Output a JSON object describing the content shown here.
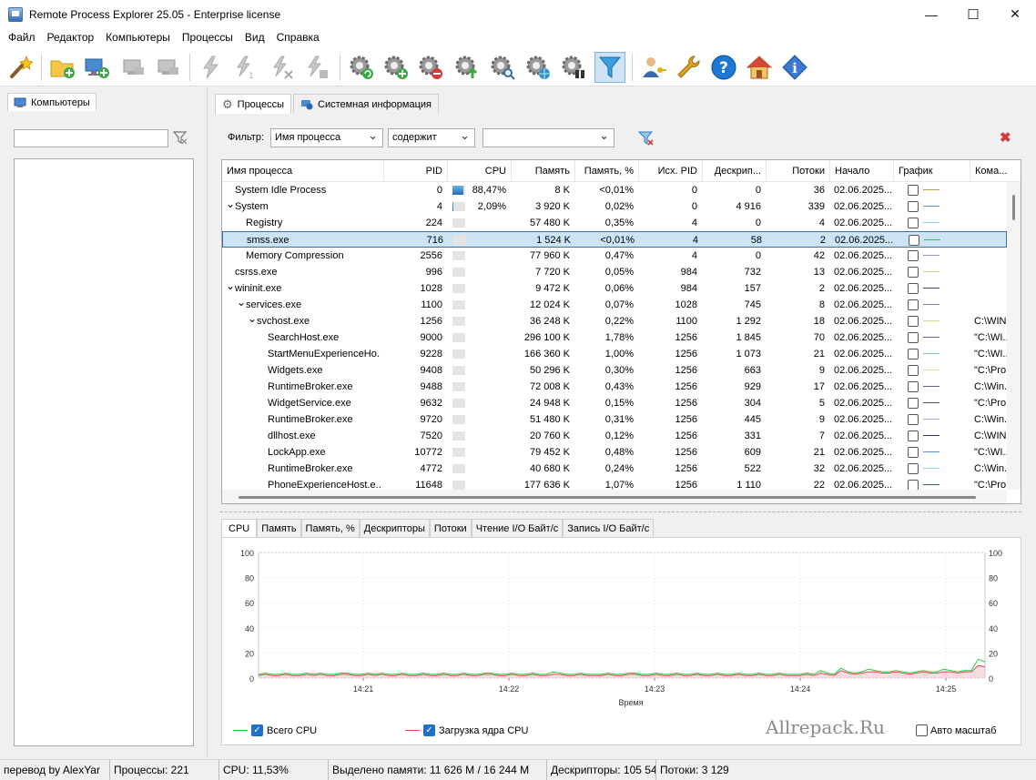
{
  "window": {
    "title": "Remote Process Explorer 25.05 - Enterprise license",
    "minimize": "—",
    "maximize": "☐",
    "close": "✕"
  },
  "menu": [
    "Файл",
    "Редактор",
    "Компьютеры",
    "Процессы",
    "Вид",
    "Справка"
  ],
  "toolbar_icons": [
    "wizard-icon",
    "add-folder-icon",
    "add-computer-icon",
    "computer-disabled-icon",
    "computer-disabled-icon-2",
    "run-disabled-icon",
    "run-disabled-icon-2",
    "run-disabled-icon-3",
    "run-disabled-icon-4",
    "gear-refresh-icon",
    "gear-add-icon",
    "gear-remove-icon",
    "gear-up-icon",
    "gear-search-icon",
    "gear-globe-icon",
    "gear-binoculars-icon",
    "filter-icon",
    "user-key-icon",
    "wrench-icon",
    "help-icon",
    "home-icon",
    "info-icon"
  ],
  "left": {
    "tab_label": "Компьютеры",
    "search_value": ""
  },
  "tabs": {
    "processes": "Процессы",
    "sysinfo": "Системная информация"
  },
  "filter": {
    "label": "Фильтр:",
    "field": "Имя процесса",
    "condition": "содержит",
    "value": ""
  },
  "columns": [
    "Имя процесса",
    "PID",
    "CPU",
    "Память",
    "Память, %",
    "Исх. PID",
    "Дескрип...",
    "Потоки",
    "Начало",
    "График",
    "Кома..."
  ],
  "rows": [
    {
      "name": "System Idle Process",
      "indent": 0,
      "expand": "",
      "pid": "0",
      "cpu": "88,47%",
      "cpu_level": 0.88,
      "mem": "8 K",
      "mem_pct": "<0,01%",
      "ppid": "0",
      "handles": "0",
      "threads": "36",
      "start": "02.06.2025...",
      "graph_color": "#b59a5a",
      "cmd": "",
      "selected": false
    },
    {
      "name": "System",
      "indent": 0,
      "expand": "⌄",
      "pid": "4",
      "cpu": "2,09%",
      "cpu_level": 0.1,
      "mem": "3 920 K",
      "mem_pct": "0,02%",
      "ppid": "0",
      "handles": "4 916",
      "threads": "339",
      "start": "02.06.2025...",
      "graph_color": "#5a9bd8",
      "cmd": "",
      "selected": false
    },
    {
      "name": "Registry",
      "indent": 1,
      "expand": "",
      "pid": "224",
      "cpu": "",
      "cpu_level": 0,
      "mem": "57 480 K",
      "mem_pct": "0,35%",
      "ppid": "4",
      "handles": "0",
      "threads": "4",
      "start": "02.06.2025...",
      "graph_color": "#9ccbe8",
      "cmd": "",
      "selected": false
    },
    {
      "name": "smss.exe",
      "indent": 1,
      "expand": "",
      "pid": "716",
      "cpu": "",
      "cpu_level": 0,
      "mem": "1 524 K",
      "mem_pct": "<0,01%",
      "ppid": "4",
      "handles": "58",
      "threads": "2",
      "start": "02.06.2025...",
      "graph_color": "#3cb371",
      "cmd": "",
      "selected": true
    },
    {
      "name": "Memory Compression",
      "indent": 1,
      "expand": "",
      "pid": "2556",
      "cpu": "",
      "cpu_level": 0,
      "mem": "77 960 K",
      "mem_pct": "0,47%",
      "ppid": "4",
      "handles": "0",
      "threads": "42",
      "start": "02.06.2025...",
      "graph_color": "#a78bd0",
      "cmd": "",
      "selected": false
    },
    {
      "name": "csrss.exe",
      "indent": 0,
      "expand": "",
      "pid": "996",
      "cpu": "",
      "cpu_level": 0,
      "mem": "7 720 K",
      "mem_pct": "0,05%",
      "ppid": "984",
      "handles": "732",
      "threads": "13",
      "start": "02.06.2025...",
      "graph_color": "#c9d98a",
      "cmd": "",
      "selected": false
    },
    {
      "name": "wininit.exe",
      "indent": 0,
      "expand": "⌄",
      "pid": "1028",
      "cpu": "",
      "cpu_level": 0,
      "mem": "9 472 K",
      "mem_pct": "0,06%",
      "ppid": "984",
      "handles": "157",
      "threads": "2",
      "start": "02.06.2025...",
      "graph_color": "#3a4a8a",
      "cmd": "",
      "selected": false
    },
    {
      "name": "services.exe",
      "indent": 1,
      "expand": "⌄",
      "pid": "1100",
      "cpu": "",
      "cpu_level": 0,
      "mem": "12 024 K",
      "mem_pct": "0,07%",
      "ppid": "1028",
      "handles": "745",
      "threads": "8",
      "start": "02.06.2025...",
      "graph_color": "#8a7ab8",
      "cmd": "",
      "selected": false
    },
    {
      "name": "svchost.exe",
      "indent": 2,
      "expand": "⌄",
      "pid": "1256",
      "cpu": "",
      "cpu_level": 0,
      "mem": "36 248 K",
      "mem_pct": "0,22%",
      "ppid": "1100",
      "handles": "1 292",
      "threads": "18",
      "start": "02.06.2025...",
      "graph_color": "#d8d89a",
      "cmd": "C:\\WIN",
      "selected": false
    },
    {
      "name": "SearchHost.exe",
      "indent": 3,
      "expand": "",
      "pid": "9000",
      "cpu": "",
      "cpu_level": 0,
      "mem": "296 100 K",
      "mem_pct": "1,78%",
      "ppid": "1256",
      "handles": "1 845",
      "threads": "70",
      "start": "02.06.2025...",
      "graph_color": "#5a6aa8",
      "cmd": "\"C:\\WI...",
      "selected": false
    },
    {
      "name": "StartMenuExperienceHo...",
      "indent": 3,
      "expand": "",
      "pid": "9228",
      "cpu": "",
      "cpu_level": 0,
      "mem": "166 360 K",
      "mem_pct": "1,00%",
      "ppid": "1256",
      "handles": "1 073",
      "threads": "21",
      "start": "02.06.2025...",
      "graph_color": "#7ac8b0",
      "cmd": "\"C:\\WI...",
      "selected": false
    },
    {
      "name": "Widgets.exe",
      "indent": 3,
      "expand": "",
      "pid": "9408",
      "cpu": "",
      "cpu_level": 0,
      "mem": "50 296 K",
      "mem_pct": "0,30%",
      "ppid": "1256",
      "handles": "663",
      "threads": "9",
      "start": "02.06.2025...",
      "graph_color": "#d8e09a",
      "cmd": "\"C:\\Pro",
      "selected": false
    },
    {
      "name": "RuntimeBroker.exe",
      "indent": 3,
      "expand": "",
      "pid": "9488",
      "cpu": "",
      "cpu_level": 0,
      "mem": "72 008 K",
      "mem_pct": "0,43%",
      "ppid": "1256",
      "handles": "929",
      "threads": "17",
      "start": "02.06.2025...",
      "graph_color": "#6a5a9a",
      "cmd": "C:\\Win.",
      "selected": false
    },
    {
      "name": "WidgetService.exe",
      "indent": 3,
      "expand": "",
      "pid": "9632",
      "cpu": "",
      "cpu_level": 0,
      "mem": "24 948 K",
      "mem_pct": "0,15%",
      "ppid": "1256",
      "handles": "304",
      "threads": "5",
      "start": "02.06.2025...",
      "graph_color": "#555",
      "cmd": "\"C:\\Pro",
      "selected": false
    },
    {
      "name": "RuntimeBroker.exe",
      "indent": 3,
      "expand": "",
      "pid": "9720",
      "cpu": "",
      "cpu_level": 0,
      "mem": "51 480 K",
      "mem_pct": "0,31%",
      "ppid": "1256",
      "handles": "445",
      "threads": "9",
      "start": "02.06.2025...",
      "graph_color": "#b89ad8",
      "cmd": "C:\\Win.",
      "selected": false
    },
    {
      "name": "dllhost.exe",
      "indent": 3,
      "expand": "",
      "pid": "7520",
      "cpu": "",
      "cpu_level": 0,
      "mem": "20 760 K",
      "mem_pct": "0,12%",
      "ppid": "1256",
      "handles": "331",
      "threads": "7",
      "start": "02.06.2025...",
      "graph_color": "#2a3a7a",
      "cmd": "C:\\WIN",
      "selected": false
    },
    {
      "name": "LockApp.exe",
      "indent": 3,
      "expand": "",
      "pid": "10772",
      "cpu": "",
      "cpu_level": 0,
      "mem": "79 452 K",
      "mem_pct": "0,48%",
      "ppid": "1256",
      "handles": "609",
      "threads": "21",
      "start": "02.06.2025...",
      "graph_color": "#5a8ad8",
      "cmd": "\"C:\\WI...",
      "selected": false
    },
    {
      "name": "RuntimeBroker.exe",
      "indent": 3,
      "expand": "",
      "pid": "4772",
      "cpu": "",
      "cpu_level": 0,
      "mem": "40 680 K",
      "mem_pct": "0,24%",
      "ppid": "1256",
      "handles": "522",
      "threads": "32",
      "start": "02.06.2025...",
      "graph_color": "#8adcc8",
      "cmd": "C:\\Win.",
      "selected": false
    },
    {
      "name": "PhoneExperienceHost.e...",
      "indent": 3,
      "expand": "",
      "pid": "11648",
      "cpu": "",
      "cpu_level": 0,
      "mem": "177 636 K",
      "mem_pct": "1,07%",
      "ppid": "1256",
      "handles": "1 110",
      "threads": "22",
      "start": "02.06.2025...",
      "graph_color": "#3a5aa8",
      "cmd": "\"C:\\Pro",
      "selected": false
    }
  ],
  "chart_tabs": [
    "CPU",
    "Память",
    "Память, %",
    "Дескрипторы",
    "Потоки",
    "Чтение I/O Байт/с",
    "Запись I/O Байт/с"
  ],
  "chart_data": {
    "type": "line",
    "xlabel": "Время",
    "ylabel": "",
    "ylim": [
      0,
      100
    ],
    "yticks": [
      "0",
      "20",
      "40",
      "60",
      "80",
      "100"
    ],
    "xticks": [
      "14:21",
      "14:22",
      "14:23",
      "14:24",
      "14:25"
    ],
    "series": [
      {
        "name": "Всего CPU",
        "color": "#2ecc40",
        "values": [
          3,
          4,
          3,
          3,
          4,
          3,
          3,
          4,
          3,
          4,
          3,
          3,
          4,
          4,
          3,
          3,
          4,
          3,
          4,
          3,
          3,
          4,
          3,
          3,
          4,
          3,
          3,
          4,
          3,
          3,
          4,
          3,
          3,
          4,
          4,
          3,
          3,
          4,
          3,
          3,
          4,
          3,
          3,
          5,
          4,
          3,
          3,
          4,
          3,
          3,
          3,
          4,
          3,
          3,
          4,
          4,
          3,
          3,
          4,
          3,
          3,
          4,
          3,
          3,
          4,
          3,
          3,
          4,
          3,
          3,
          4,
          3,
          3,
          4,
          3,
          3,
          4,
          3,
          3,
          3,
          4,
          3,
          6,
          4,
          3,
          8,
          5,
          4,
          5,
          7,
          6,
          5,
          5,
          6,
          5,
          4,
          5,
          6,
          5,
          5,
          7,
          6,
          5,
          6,
          6,
          15,
          13
        ]
      },
      {
        "name": "Загрузка ядра CPU",
        "color": "#e04a5a",
        "values": [
          2,
          3,
          2,
          2,
          3,
          2,
          2,
          3,
          2,
          3,
          2,
          2,
          3,
          3,
          2,
          2,
          3,
          2,
          3,
          2,
          2,
          3,
          2,
          2,
          3,
          2,
          2,
          3,
          2,
          2,
          3,
          2,
          2,
          3,
          3,
          2,
          2,
          3,
          2,
          2,
          3,
          2,
          2,
          3,
          3,
          2,
          2,
          3,
          2,
          2,
          2,
          3,
          2,
          2,
          3,
          3,
          2,
          2,
          3,
          2,
          2,
          3,
          2,
          2,
          3,
          2,
          2,
          3,
          2,
          2,
          3,
          2,
          2,
          3,
          2,
          2,
          3,
          2,
          2,
          2,
          3,
          2,
          4,
          3,
          2,
          6,
          4,
          3,
          4,
          5,
          5,
          4,
          4,
          5,
          4,
          3,
          4,
          5,
          4,
          4,
          5,
          5,
          4,
          5,
          5,
          10,
          9
        ]
      }
    ],
    "legend_placement": "bottom"
  },
  "legend": {
    "total": "Всего CPU",
    "kernel": "Загрузка ядра CPU",
    "auto_scale": "Авто масштаб",
    "watermark": "Allrepack.Ru"
  },
  "status": {
    "translator": "перевод by AlexYar",
    "processes": "Процессы: 221",
    "cpu": "CPU: 11,53%",
    "memory": "Выделено памяти: 11 626 M / 16 244 M",
    "handles": "Дескрипторы: 105 54",
    "threads": "Потоки: 3 129"
  }
}
